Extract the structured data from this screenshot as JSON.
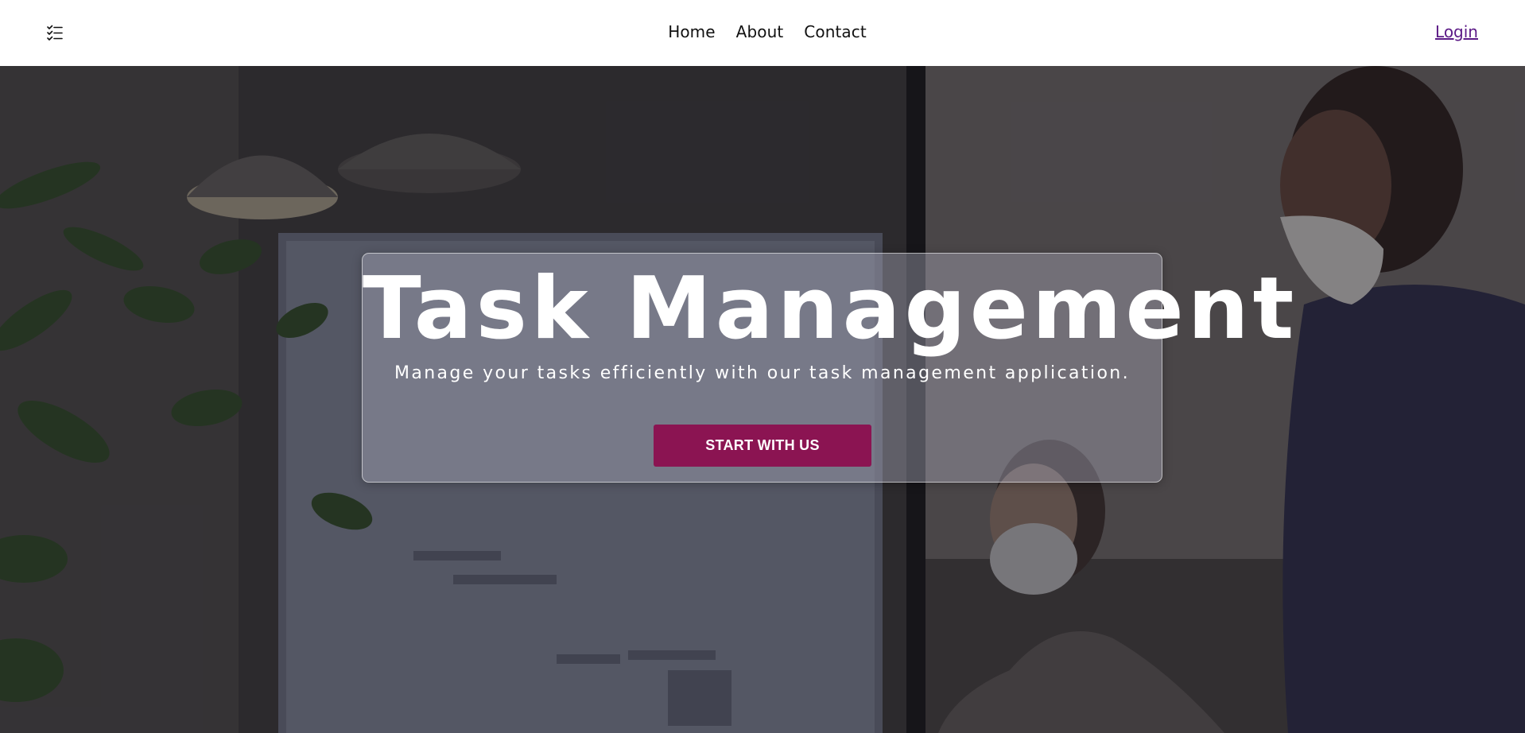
{
  "navbar": {
    "logo_icon": "checklist-icon",
    "links": [
      {
        "label": "Home"
      },
      {
        "label": "About"
      },
      {
        "label": "Contact"
      }
    ],
    "login_label": "Login",
    "colors": {
      "login": "#5b1a86",
      "text": "#111111"
    }
  },
  "hero": {
    "title": "Task Management",
    "subtitle": "Manage your tasks efficiently with our task management application.",
    "cta_label": "START WITH US",
    "colors": {
      "cta": "#8b1452",
      "title": "#ffffff"
    }
  }
}
